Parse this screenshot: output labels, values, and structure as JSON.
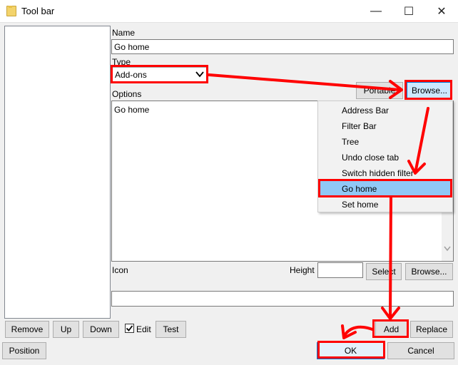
{
  "window": {
    "title": "Tool bar",
    "minimize": "—",
    "maximize": "☐",
    "close": "✕"
  },
  "form": {
    "name_label": "Name",
    "name_value": "Go home",
    "type_label": "Type",
    "type_value": "Add-ons",
    "options_label": "Options",
    "options_value": "Go home",
    "icon_label": "Icon",
    "height_label": "Height",
    "height_value": "",
    "icon_path_value": ""
  },
  "buttons": {
    "portable": "Portable",
    "browse_top": "Browse...",
    "select": "Select",
    "browse_icon": "Browse...",
    "remove": "Remove",
    "up": "Up",
    "down": "Down",
    "edit": "Edit",
    "test": "Test",
    "add": "Add",
    "replace": "Replace",
    "position": "Position",
    "ok": "OK",
    "cancel": "Cancel"
  },
  "edit_checked": true,
  "menu": {
    "items": [
      "Address Bar",
      "Filter Bar",
      "Tree",
      "Undo close tab",
      "Switch hidden filter",
      "Go home",
      "Set home"
    ],
    "selected_index": 5
  },
  "annotation_color": "#ff0000",
  "selection_color": "#90c8f6"
}
